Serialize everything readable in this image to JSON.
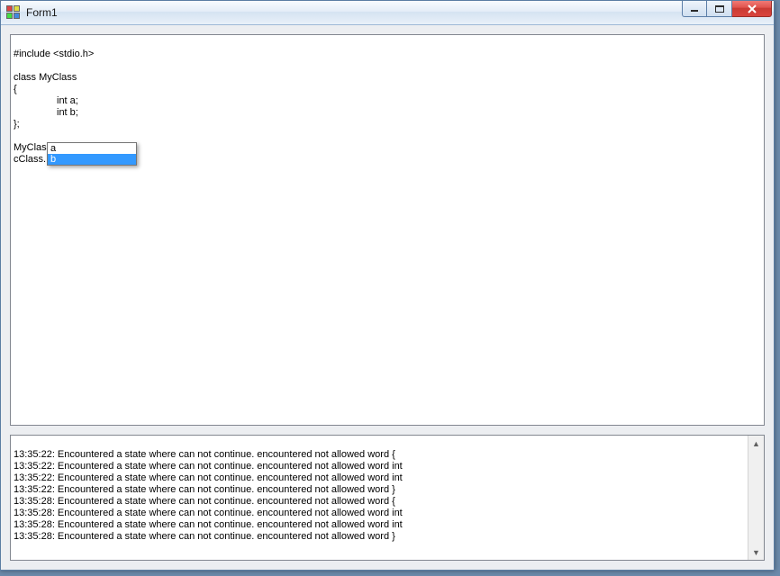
{
  "window": {
    "title": "Form1"
  },
  "editor": {
    "lines": {
      "l0": "#include <stdio.h>",
      "l1": "",
      "l2": "class MyClass",
      "l3": "{",
      "l4_indent": "int a;",
      "l5_indent": "int b;",
      "l6": "};",
      "l7": "",
      "l8": "MyClass cClass;",
      "l9": "cClass."
    }
  },
  "autocomplete": {
    "items": {
      "i0": "a",
      "i1": "b"
    },
    "selected_index": 1
  },
  "log": {
    "lines": {
      "l0": "13:35:22: Encountered a state where can not continue. encountered not allowed word {",
      "l1": "13:35:22: Encountered a state where can not continue. encountered not allowed word int",
      "l2": "13:35:22: Encountered a state where can not continue. encountered not allowed word int",
      "l3": "13:35:22: Encountered a state where can not continue. encountered not allowed word }",
      "l4": "13:35:28: Encountered a state where can not continue. encountered not allowed word {",
      "l5": "13:35:28: Encountered a state where can not continue. encountered not allowed word int",
      "l6": "13:35:28: Encountered a state where can not continue. encountered not allowed word int",
      "l7": "13:35:28: Encountered a state where can not continue. encountered not allowed word }"
    }
  }
}
